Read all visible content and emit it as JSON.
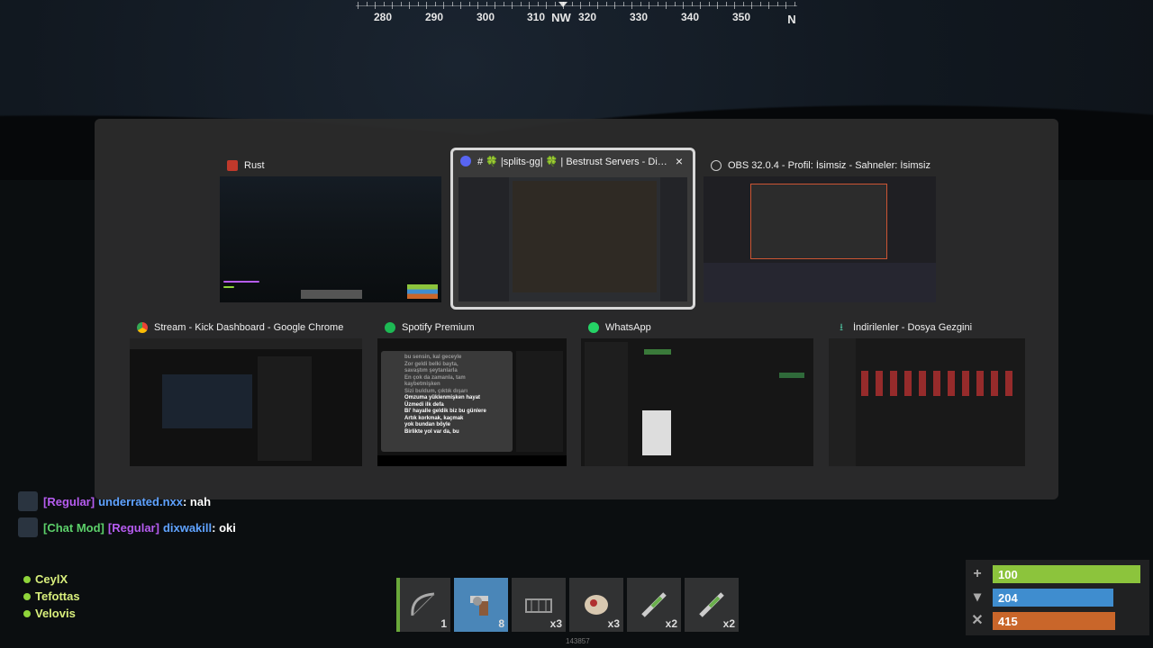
{
  "compass": {
    "labels": [
      "280",
      "290",
      "300",
      "310",
      "NW",
      "320",
      "330",
      "340",
      "350",
      "N"
    ]
  },
  "switcher": {
    "windows": [
      {
        "title": "Rust",
        "icon": "rust-icon"
      },
      {
        "title": "# 🍀 |splits-gg| 🍀 | Bestrust Servers - Discord",
        "icon": "discord-icon"
      },
      {
        "title": "OBS 32.0.4 - Profil: İsimsiz - Sahneler: İsimsiz",
        "icon": "obs-icon"
      },
      {
        "title": "Stream - Kick Dashboard - Google Chrome",
        "icon": "chrome-icon"
      },
      {
        "title": "Spotify Premium",
        "icon": "spotify-icon"
      },
      {
        "title": "WhatsApp",
        "icon": "whatsapp-icon"
      },
      {
        "title": "İndirilenler - Dosya Gezgini",
        "icon": "downloads-icon"
      }
    ],
    "spotify_lyrics": [
      "bu sensin, kal geceyle",
      "Zor geldi belki bayta,",
      "savaştım şeytanlarla",
      "En çok da zamanla, tam kaybetmişken",
      "Sizi buldum, çıktık dışarı",
      "Omzuma yüklenmişken hayat",
      "Üzmedi ilk defa",
      "Bi' hayalle geldik biz bu günlere",
      "Artık korkmak, kaçmak",
      "yok bundan böyle",
      "Birlikte yol var da, bu"
    ]
  },
  "chat": {
    "messages": [
      {
        "badges": "",
        "role": "[Regular]",
        "user": "underrated.nxx",
        "text": ": nah"
      },
      {
        "badges": "[Chat Mod]",
        "role": "[Regular]",
        "user": "dixwakill",
        "text": ": oki"
      }
    ]
  },
  "team": {
    "members": [
      "CeylX",
      "Tefottas",
      "Velovis"
    ]
  },
  "hotbar": {
    "slots": [
      {
        "item": "bow",
        "count": "1"
      },
      {
        "item": "revolver",
        "count": "8"
      },
      {
        "item": "barricade",
        "count": "x3"
      },
      {
        "item": "bandage",
        "count": "x3"
      },
      {
        "item": "syringe",
        "count": "x2"
      },
      {
        "item": "syringe",
        "count": "x2"
      }
    ],
    "footer_id": "143857"
  },
  "stats": {
    "health": {
      "value": "100",
      "fraction": 1.0,
      "color": "#8cc43c"
    },
    "water": {
      "value": "204",
      "fraction": 0.82,
      "color": "#3f8dcf"
    },
    "food": {
      "value": "415",
      "fraction": 0.83,
      "color": "#c9662a"
    }
  }
}
